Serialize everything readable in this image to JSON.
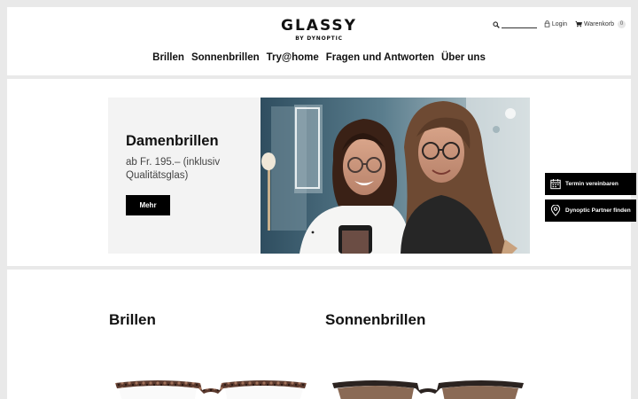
{
  "brand": {
    "name": "GLASSY",
    "tagline": "BY DYNOPTIC"
  },
  "utility": {
    "search_placeholder": "",
    "login_label": "Login",
    "cart_label": "Warenkorb",
    "cart_count": "0"
  },
  "nav": {
    "items": [
      {
        "label": "Brillen"
      },
      {
        "label": "Sonnenbrillen"
      },
      {
        "label": "Try@home"
      },
      {
        "label": "Fragen und Antworten"
      },
      {
        "label": "Über uns"
      }
    ]
  },
  "hero": {
    "title": "Damenbrillen",
    "subtitle": "ab Fr. 195.– (inklusiv Qualitätsglas)",
    "button_label": "Mehr"
  },
  "side_buttons": {
    "appointment_label": "Termin vereinbaren",
    "partner_label": "Dynoptic Partner finden"
  },
  "products": {
    "glasses_title": "Brillen",
    "sunglasses_title": "Sonnenbrillen"
  },
  "icons": [
    "search-icon",
    "lock-icon",
    "cart-icon",
    "calendar-icon",
    "location-pin-icon"
  ],
  "colors": {
    "accent": "#000000",
    "background": "#e9e9e9",
    "card": "#ffffff",
    "hero_panel": "#f3f3f3"
  }
}
